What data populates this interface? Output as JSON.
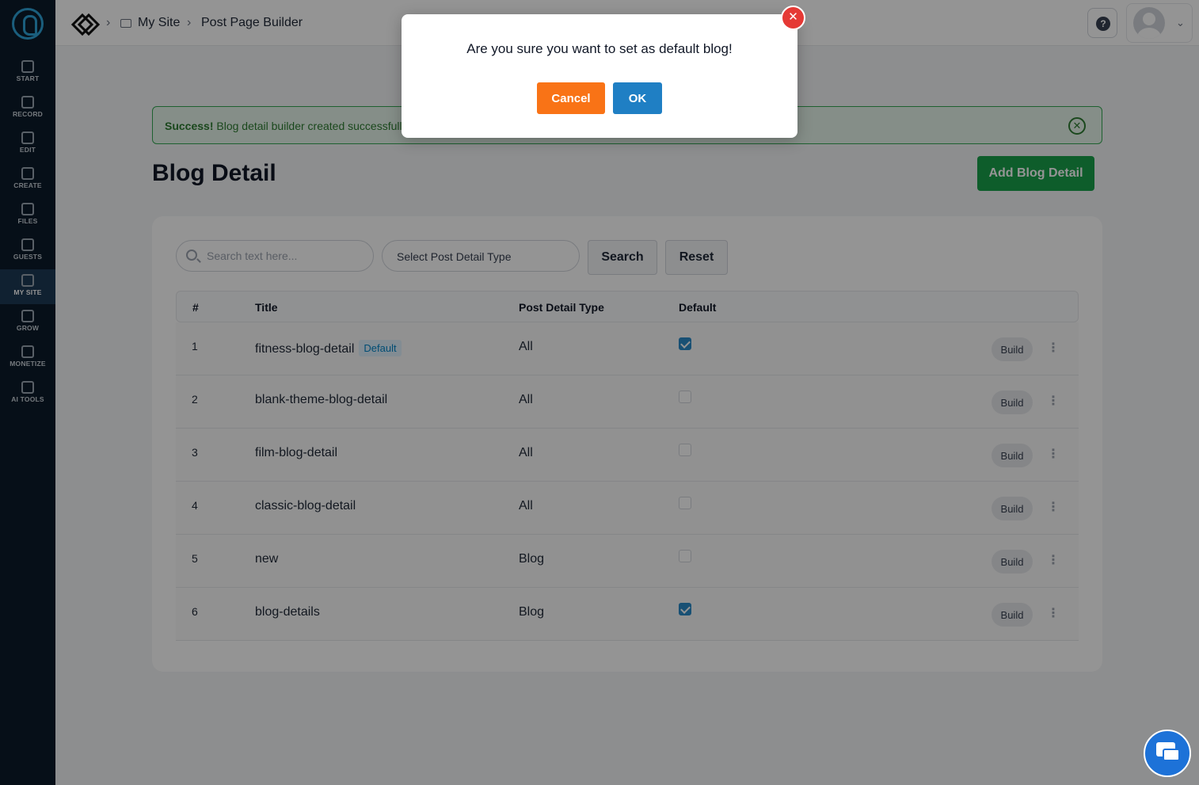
{
  "sidebar": {
    "items": [
      {
        "label": "START",
        "icon": "start-icon"
      },
      {
        "label": "RECORD",
        "icon": "microphone-icon"
      },
      {
        "label": "EDIT",
        "icon": "edit-icon"
      },
      {
        "label": "CREATE",
        "icon": "create-icon"
      },
      {
        "label": "FILES",
        "icon": "files-icon"
      },
      {
        "label": "GUESTS",
        "icon": "guests-icon"
      },
      {
        "label": "MY SITE",
        "icon": "my-site-icon",
        "active": true
      },
      {
        "label": "GROW",
        "icon": "grow-icon"
      },
      {
        "label": "MONETIZE",
        "icon": "monetize-icon"
      },
      {
        "label": "AI TOOLS",
        "icon": "ai-tools-icon"
      }
    ]
  },
  "breadcrumb": {
    "items": [
      "My Site",
      "Post Page Builder"
    ]
  },
  "alert": {
    "strong": "Success!",
    "message": " Blog detail builder created successfully."
  },
  "page": {
    "title": "Blog Detail",
    "add_button": "Add Blog Detail"
  },
  "filters": {
    "search_placeholder": "Search text here...",
    "select_label": "Select Post Detail Type",
    "search_button": "Search",
    "reset_button": "Reset"
  },
  "table": {
    "headers": [
      "#",
      "Title",
      "Post Detail Type",
      "Default"
    ],
    "build_label": "Build",
    "default_badge": "Default",
    "rows": [
      {
        "num": "1",
        "title": "fitness-blog-detail",
        "badge": true,
        "type": "All",
        "default": true
      },
      {
        "num": "2",
        "title": "blank-theme-blog-detail",
        "badge": false,
        "type": "All",
        "default": false
      },
      {
        "num": "3",
        "title": "film-blog-detail",
        "badge": false,
        "type": "All",
        "default": false
      },
      {
        "num": "4",
        "title": "classic-blog-detail",
        "badge": false,
        "type": "All",
        "default": false
      },
      {
        "num": "5",
        "title": "new",
        "badge": false,
        "type": "Blog",
        "default": false
      },
      {
        "num": "6",
        "title": "blog-details",
        "badge": false,
        "type": "Blog",
        "default": true
      }
    ]
  },
  "modal": {
    "question": "Are you sure you want to set as default blog!",
    "cancel": "Cancel",
    "ok": "OK",
    "close_glyph": "✕"
  },
  "colors": {
    "sidebar_bg": "#0c1a2a",
    "success_green": "#19a14a",
    "cancel_orange": "#f97316",
    "ok_blue": "#1f7fc4",
    "checkbox_blue": "#2a8ac9"
  }
}
